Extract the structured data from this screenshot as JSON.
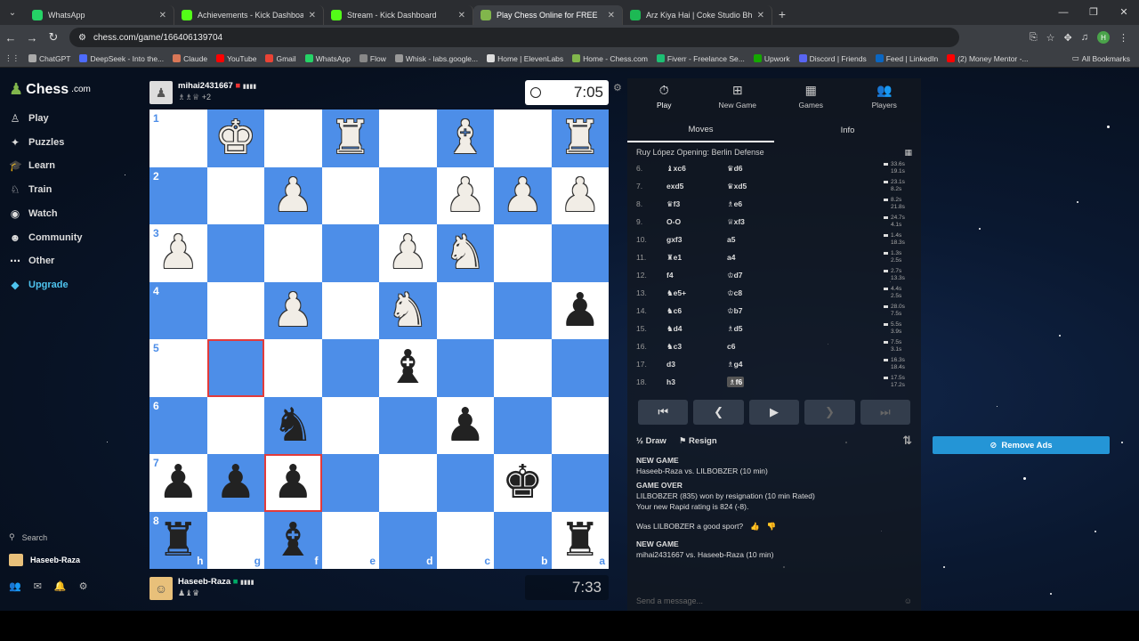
{
  "browser": {
    "tabs": [
      {
        "label": "WhatsApp",
        "icon": "whatsapp-icon",
        "color": "#25d366"
      },
      {
        "label": "Achievements - Kick Dashboard",
        "icon": "kick-icon",
        "color": "#53fc18"
      },
      {
        "label": "Stream - Kick Dashboard",
        "icon": "kick-icon",
        "color": "#53fc18"
      },
      {
        "label": "Play Chess Online for FREE",
        "icon": "chess-icon",
        "color": "#81b64c",
        "active": true
      },
      {
        "label": "Arz Kiya Hai | Coke Studio Bhar",
        "icon": "spotify-icon",
        "color": "#1db954"
      }
    ],
    "url": "chess.com/game/166406139704",
    "profile_initial": "H",
    "bookmarks": [
      {
        "label": "ChatGPT",
        "color": "#aaa"
      },
      {
        "label": "DeepSeek - Into the...",
        "color": "#4d6bfe"
      },
      {
        "label": "Claude",
        "color": "#d97757"
      },
      {
        "label": "YouTube",
        "color": "#ff0000"
      },
      {
        "label": "Gmail",
        "color": "#ea4335"
      },
      {
        "label": "WhatsApp",
        "color": "#25d366"
      },
      {
        "label": "Flow",
        "color": "#888"
      },
      {
        "label": "Whisk - labs.google...",
        "color": "#999"
      },
      {
        "label": "Home | ElevenLabs",
        "color": "#ddd"
      },
      {
        "label": "Home - Chess.com",
        "color": "#81b64c"
      },
      {
        "label": "Fiverr - Freelance Se...",
        "color": "#1dbf73"
      },
      {
        "label": "Upwork",
        "color": "#14a800"
      },
      {
        "label": "Discord | Friends",
        "color": "#5865f2"
      },
      {
        "label": "Feed | LinkedIn",
        "color": "#0a66c2"
      },
      {
        "label": "(2) Money Mentor -...",
        "color": "#ff0000"
      }
    ],
    "all_bookmarks": "All Bookmarks"
  },
  "sidebar": {
    "logo": "Chess",
    "logo_suffix": ".com",
    "items": [
      {
        "label": "Play",
        "icon": "play-icon"
      },
      {
        "label": "Puzzles",
        "icon": "puzzle-icon"
      },
      {
        "label": "Learn",
        "icon": "learn-icon"
      },
      {
        "label": "Train",
        "icon": "train-icon"
      },
      {
        "label": "Watch",
        "icon": "watch-icon"
      },
      {
        "label": "Community",
        "icon": "community-icon"
      },
      {
        "label": "Other",
        "icon": "more-icon"
      },
      {
        "label": "Upgrade",
        "icon": "diamond-icon"
      }
    ],
    "search": "Search",
    "user": "Haseeb-Raza"
  },
  "top_player": {
    "name": "mihai2431667",
    "captured": "♗♗♕ +2",
    "clock": "7:05"
  },
  "bottom_player": {
    "name": "Haseeb-Raza",
    "captured": "♟♝♛",
    "clock": "7:33"
  },
  "board": {
    "ranks": [
      "1",
      "2",
      "3",
      "4",
      "5",
      "6",
      "7",
      "8"
    ],
    "files": [
      "h",
      "g",
      "f",
      "e",
      "d",
      "c",
      "b",
      "a"
    ],
    "rows": [
      [
        "",
        "wK",
        "",
        "wR",
        "",
        "wB",
        "",
        "wR"
      ],
      [
        "",
        "",
        "wP",
        "",
        "",
        "wP",
        "wP",
        "wP"
      ],
      [
        "wP",
        "",
        "",
        "",
        "wP",
        "wN",
        "",
        ""
      ],
      [
        "",
        "",
        "wP",
        "",
        "wN",
        "",
        "",
        "bP"
      ],
      [
        "",
        "",
        "",
        "",
        "bB",
        "",
        "",
        ""
      ],
      [
        "",
        "",
        "bN",
        "",
        "",
        "bP",
        "",
        ""
      ],
      [
        "bP",
        "bP",
        "bP",
        "",
        "",
        "",
        "bK",
        ""
      ],
      [
        "bR",
        "",
        "bB",
        "",
        "",
        "",
        "",
        "bR"
      ]
    ],
    "highlights": [
      "4-1",
      "6-2"
    ]
  },
  "panel": {
    "tabs": [
      {
        "label": "Play",
        "icon": "stopwatch-icon"
      },
      {
        "label": "New Game",
        "icon": "plus-icon"
      },
      {
        "label": "Games",
        "icon": "games-icon"
      },
      {
        "label": "Players",
        "icon": "players-icon"
      }
    ],
    "subtabs": [
      "Moves",
      "Info"
    ],
    "opening": "Ruy López Opening: Berlin Defense",
    "moves": [
      {
        "n": "6.",
        "w": "♝xc6",
        "b": "♛d6",
        "t1": "33.6s",
        "t2": "19.1s"
      },
      {
        "n": "7.",
        "w": "exd5",
        "b": "♛xd5",
        "t1": "23.1s",
        "t2": "8.2s"
      },
      {
        "n": "8.",
        "w": "♛f3",
        "b": "♗e6",
        "t1": "8.2s",
        "t2": "21.8s"
      },
      {
        "n": "9.",
        "w": "O-O",
        "b": "♕xf3",
        "t1": "24.7s",
        "t2": "4.1s"
      },
      {
        "n": "10.",
        "w": "gxf3",
        "b": "a5",
        "t1": "1.4s",
        "t2": "18.3s"
      },
      {
        "n": "11.",
        "w": "♜e1",
        "b": "a4",
        "t1": "1.3s",
        "t2": "2.5s"
      },
      {
        "n": "12.",
        "w": "f4",
        "b": "♔d7",
        "t1": "2.7s",
        "t2": "13.3s"
      },
      {
        "n": "13.",
        "w": "♞e5+",
        "b": "♔c8",
        "t1": "4.4s",
        "t2": "2.5s"
      },
      {
        "n": "14.",
        "w": "♞c6",
        "b": "♔b7",
        "t1": "28.0s",
        "t2": "7.5s"
      },
      {
        "n": "15.",
        "w": "♞d4",
        "b": "♗d5",
        "t1": "5.5s",
        "t2": "3.9s"
      },
      {
        "n": "16.",
        "w": "♞c3",
        "b": "c6",
        "t1": "7.5s",
        "t2": "3.1s"
      },
      {
        "n": "17.",
        "w": "d3",
        "b": "♗g4",
        "t1": "16.3s",
        "t2": "18.4s"
      },
      {
        "n": "18.",
        "w": "h3",
        "b": "♗f6",
        "t1": "17.5s",
        "t2": "17.2s",
        "current": true
      }
    ],
    "draw": "Draw",
    "resign": "Resign",
    "log": {
      "new_game_1": "NEW GAME",
      "match_1": "Haseeb-Raza vs. LILBOBZER (10 min)",
      "game_over": "GAME OVER",
      "result": "LILBOBZER (835) won by resignation (10 min Rated)",
      "rating": "Your new Rapid rating is 824 (-8).",
      "sport_q": "Was LILBOBZER a good sport?",
      "new_game_2": "NEW GAME",
      "match_2": "mihai2431667 vs. Haseeb-Raza (10 min)"
    },
    "send_placeholder": "Send a message..."
  },
  "ad": {
    "remove_ads": "Remove Ads"
  }
}
